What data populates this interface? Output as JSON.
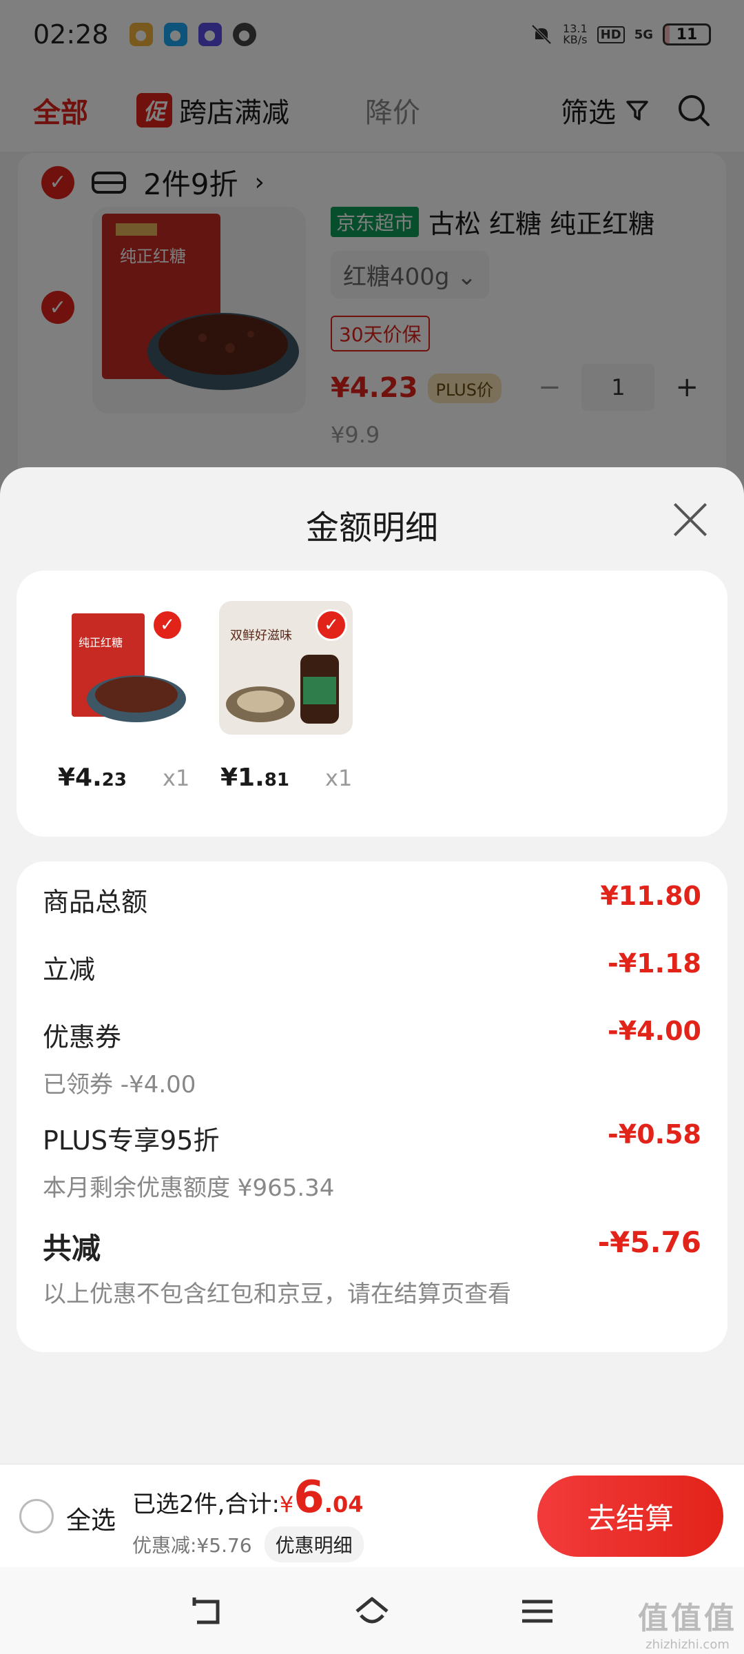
{
  "status_bar": {
    "time": "02:28",
    "net_speed": "13.1",
    "net_unit": "KB/s",
    "hd": "HD",
    "signal": "5G",
    "battery": "11",
    "battery_level": 0.11
  },
  "filter_bar": {
    "all": "全部",
    "promo_badge": "促",
    "cross_store": "跨店满减",
    "price_drop": "降价",
    "filter": "筛选"
  },
  "cart": {
    "shop_promo": "2件9折",
    "item": {
      "store_tag": "京东超市",
      "title": "古松 红糖 纯正红糖",
      "spec": "红糖400g",
      "guarantee": "30天价保",
      "price": "¥4.23",
      "plus_tag": "PLUS价",
      "original_price": "¥9.9",
      "qty": "1"
    }
  },
  "sheet": {
    "title": "金额明细",
    "items": [
      {
        "price_int": "¥4.",
        "price_dec": "23",
        "qty": "x1",
        "image": "red-sugar",
        "image_text": "纯正红糖"
      },
      {
        "price_int": "¥1.",
        "price_dec": "81",
        "qty": "x1",
        "image": "oyster-sauce",
        "image_text": "双鲜好滋味"
      }
    ],
    "rows": {
      "total_label": "商品总额",
      "total_value": "¥11.80",
      "instant_label": "立减",
      "instant_value": "-¥1.18",
      "coupon_label": "优惠券",
      "coupon_value": "-¥4.00",
      "coupon_sub": "已领券 -¥4.00",
      "plus_label": "PLUS专享95折",
      "plus_value": "-¥0.58",
      "plus_sub": "本月剩余优惠额度 ¥965.34",
      "saved_label": "共减",
      "saved_value": "-¥5.76",
      "saved_note": "以上优惠不包含红包和京豆，请在结算页查看"
    }
  },
  "bottom_bar": {
    "select_all": "全选",
    "selected_text": "已选2件,合计:",
    "currency": "¥",
    "total_int": "6",
    "total_dec": ".04",
    "discount_text": "优惠减:¥5.76",
    "detail_button": "优惠明细",
    "checkout": "去结算"
  },
  "watermark": {
    "line1": "值值值",
    "line2": "zhizhizhi.com"
  },
  "colors": {
    "accent": "#e2231a",
    "plus": "#f6e0b5"
  }
}
